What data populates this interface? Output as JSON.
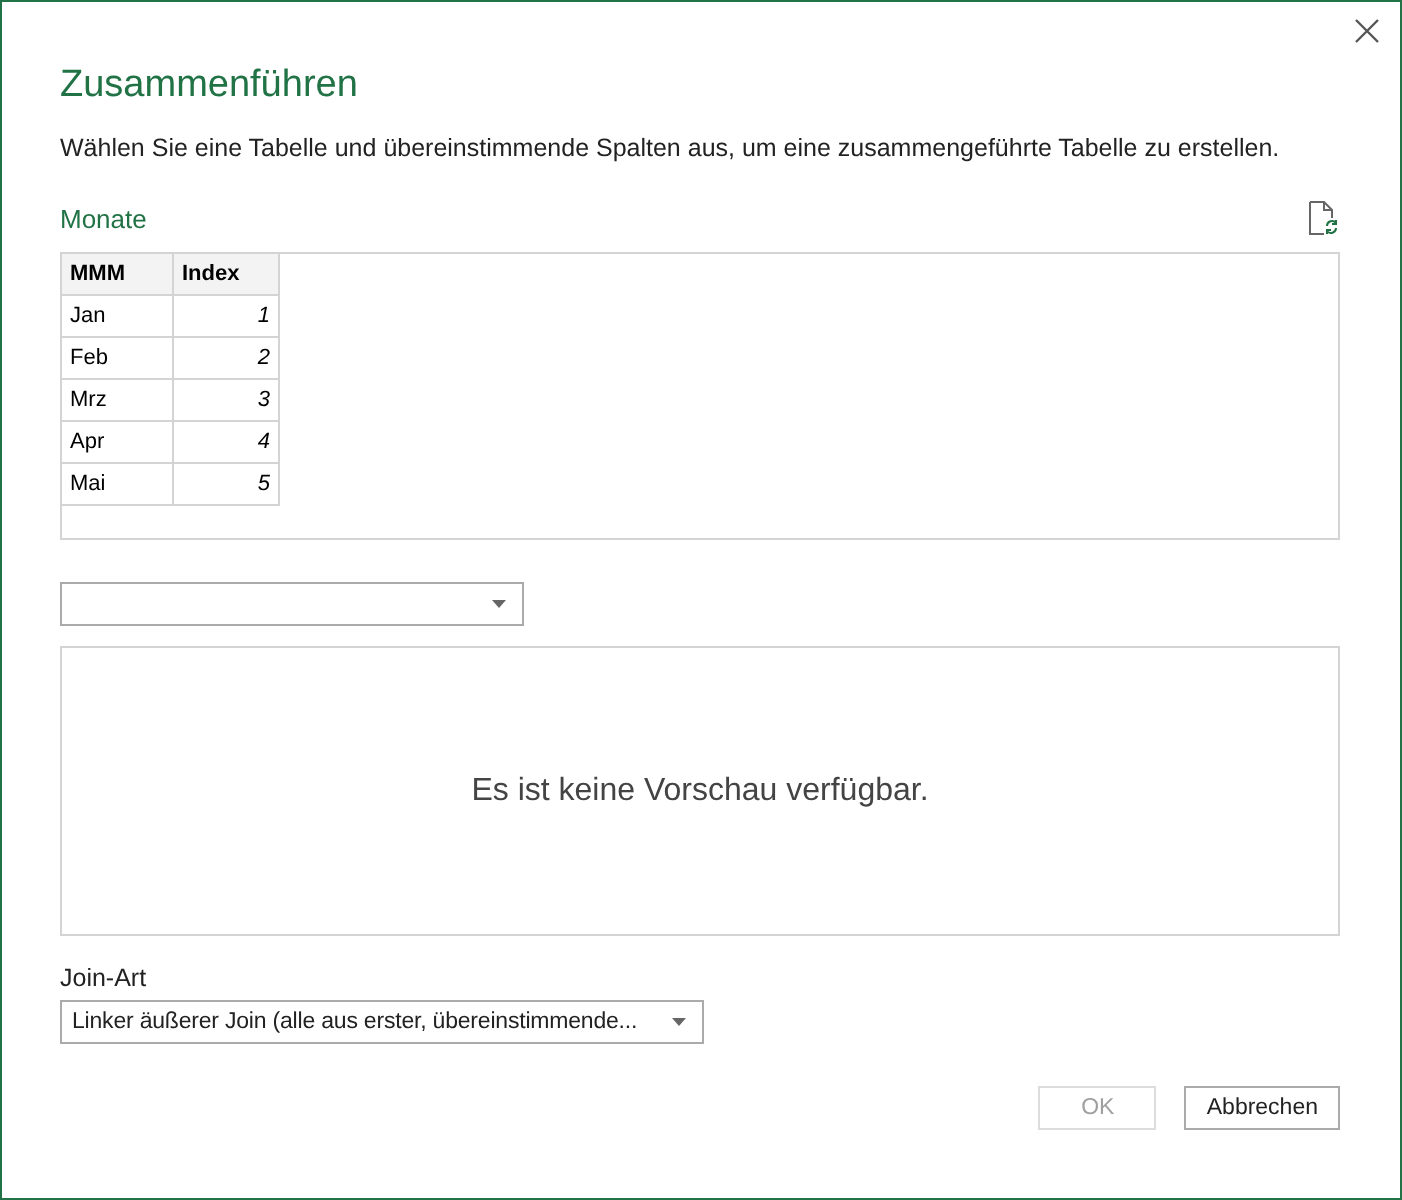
{
  "dialog": {
    "title": "Zusammenführen",
    "description": "Wählen Sie eine Tabelle und übereinstimmende Spalten aus, um eine zusammengeführte Tabelle zu erstellen."
  },
  "first_table": {
    "name": "Monate",
    "columns": [
      "MMM",
      "Index"
    ],
    "rows": [
      [
        "Jan",
        "1"
      ],
      [
        "Feb",
        "2"
      ],
      [
        "Mrz",
        "3"
      ],
      [
        "Apr",
        "4"
      ],
      [
        "Mai",
        "5"
      ]
    ]
  },
  "preview": {
    "message": "Es ist keine Vorschau verfügbar."
  },
  "join_kind": {
    "label": "Join-Art",
    "value": "Linker äußerer Join (alle aus erster, übereinstimmende..."
  },
  "buttons": [
    {
      "label": "OK",
      "disabled": true
    },
    {
      "label": "Abbrechen",
      "disabled": false
    }
  ]
}
